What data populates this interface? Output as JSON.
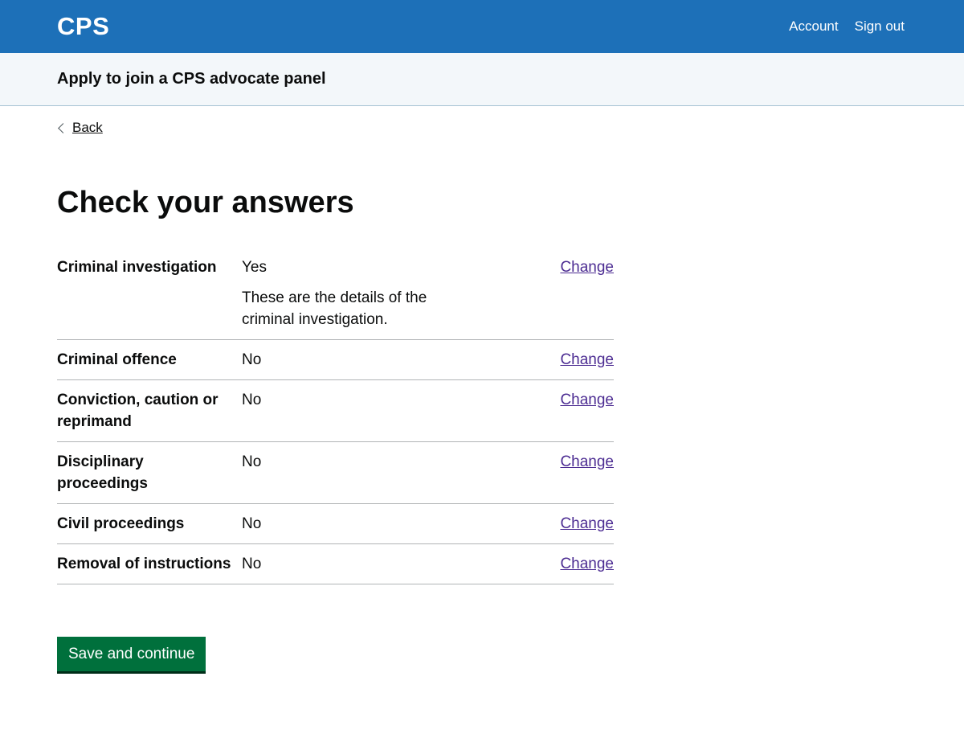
{
  "header": {
    "logo": "CPS",
    "nav": [
      "Account",
      "Sign out"
    ]
  },
  "service": {
    "name": "Apply to join a CPS advocate panel"
  },
  "back": {
    "label": "Back"
  },
  "page": {
    "title": "Check your answers"
  },
  "summary": {
    "rows": [
      {
        "key": "Criminal investigation",
        "value": "Yes",
        "detail": "These are the details of the criminal investigation.",
        "action": "Change"
      },
      {
        "key": "Criminal offence",
        "value": "No",
        "action": "Change"
      },
      {
        "key": "Conviction, caution or reprimand",
        "value": "No",
        "action": "Change"
      },
      {
        "key": "Disciplinary proceedings",
        "value": "No",
        "action": "Change"
      },
      {
        "key": "Civil proceedings",
        "value": "No",
        "action": "Change"
      },
      {
        "key": "Removal of instructions",
        "value": "No",
        "action": "Change"
      }
    ]
  },
  "actions": {
    "submit_label": "Save and continue"
  },
  "colors": {
    "header": "#1d70b8",
    "service_bar": "#f3f7fa",
    "link": "#4c2c92",
    "button": "#00703c"
  }
}
